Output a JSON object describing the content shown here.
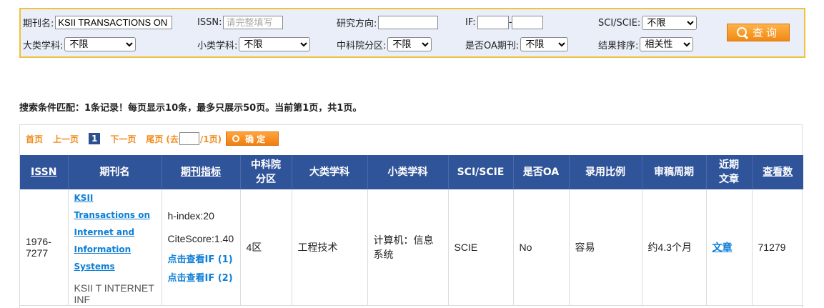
{
  "search": {
    "journal_label": "期刊名:",
    "journal_value": "KSII TRANSACTIONS ON I",
    "issn_label": "ISSN:",
    "issn_placeholder": "请完整填写",
    "research_label": "研究方向:",
    "if_label": "IF:",
    "if_sep": "-",
    "sci_label": "SCI/SCIE:",
    "sci_value": "不限",
    "major_label": "大类学科:",
    "major_value": "不限",
    "minor_label": "小类学科:",
    "minor_value": "不限",
    "cas_label": "中科院分区:",
    "cas_value": "不限",
    "oa_label": "是否OA期刊:",
    "oa_value": "不限",
    "sort_label": "结果排序:",
    "sort_value": "相关性",
    "query_button": "查询"
  },
  "summary": "搜索条件匹配：1条记录！每页显示10条，最多只展示50页。当前第1页，共1页。",
  "pager": {
    "first": "首页",
    "prev": "上一页",
    "current": "1",
    "next": "下一页",
    "last": "尾页",
    "goto_prefix": "(去",
    "goto_suffix": "/1页)",
    "ok": "确定"
  },
  "table": {
    "headers": {
      "issn": "ISSN",
      "journal": "期刊名",
      "metrics": "期刊指标",
      "cas": "中科院分区",
      "major": "大类学科",
      "minor": "小类学科",
      "sci": "SCI/SCIE",
      "oa": "是否OA",
      "acceptance": "录用比例",
      "review": "审稿周期",
      "recent": "近期文章",
      "views": "查看数"
    },
    "rows": [
      {
        "issn": "1976-7277",
        "journal_name": "KSII Transactions on Internet and Information Systems",
        "journal_abbr": "KSII T INTERNET INF",
        "h_index": "h-index:20",
        "citescore": "CiteScore:1.40",
        "if_link_1": "点击查看IF (1)",
        "if_link_2": "点击查看IF (2)",
        "cas": "4区",
        "major": "工程技术",
        "minor": "计算机：信息系统",
        "sci": "SCIE",
        "oa": "No",
        "acceptance": "容易",
        "review": "约4.3个月",
        "recent": "文章",
        "views": "71279"
      }
    ]
  }
}
